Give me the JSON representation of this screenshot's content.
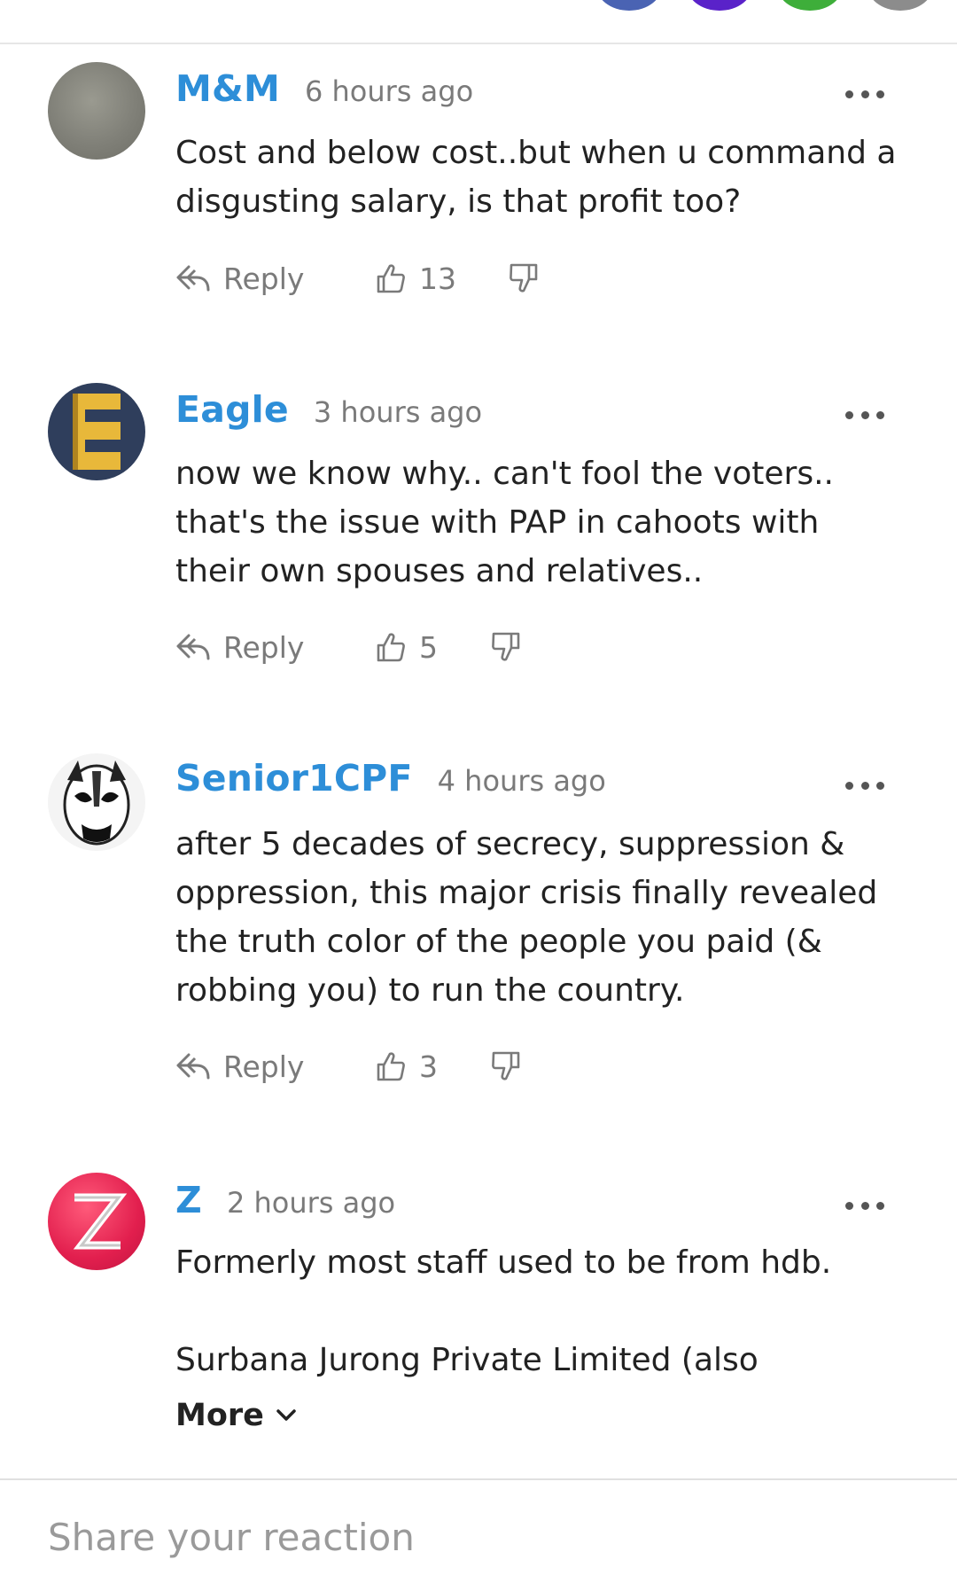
{
  "comments": [
    {
      "author": "M&M",
      "time": "6 hours ago",
      "body": "Cost and below cost..but when u command a disgusting salary, is that profit too?",
      "reply_label": "Reply",
      "likes": "13"
    },
    {
      "author": "Eagle",
      "time": "3 hours ago",
      "body": "now we know why.. can't fool the voters.. that's the issue with PAP in cahoots with their own spouses and relatives..",
      "reply_label": "Reply",
      "likes": "5"
    },
    {
      "author": "Senior1CPF",
      "time": "4 hours ago",
      "body": "after 5 decades of secrecy, suppression & oppression, this major crisis finally revealed the truth color of the people you paid (& robbing you) to run the country.",
      "reply_label": "Reply",
      "likes": "3"
    },
    {
      "author": "Z",
      "time": "2 hours ago",
      "body_line1": "Formerly most staff used to be from hdb.",
      "body_line2": "Surbana Jurong Private Limited (also",
      "more_label": "More"
    }
  ],
  "share_placeholder": "Share your reaction",
  "colors": {
    "author": "#2d8ed8",
    "muted": "#7a7a7a",
    "divider": "#e6e6e6"
  },
  "icons": [
    "reply-icon",
    "thumbs-up-icon",
    "thumbs-down-icon",
    "more-dots-icon",
    "chevron-down-icon"
  ]
}
